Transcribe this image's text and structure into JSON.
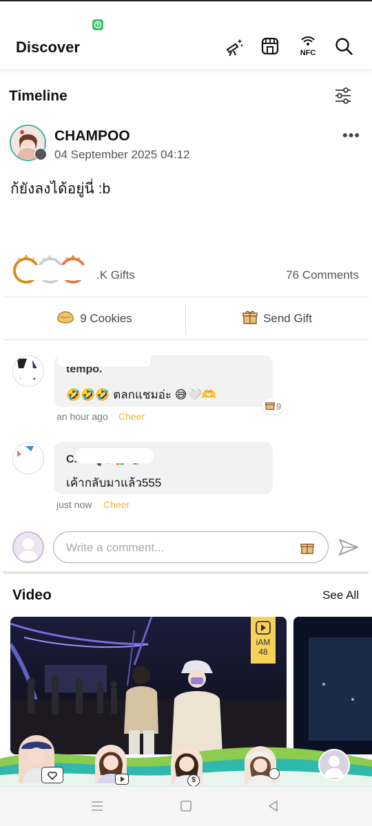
{
  "header": {
    "title": "Discover",
    "icons": [
      "telescope-icon",
      "store-icon",
      "nfc-icon",
      "search-icon"
    ],
    "nfc_label": "NFC"
  },
  "timeline": {
    "title": "Timeline",
    "post": {
      "author": "CHAMPOO",
      "date": "04 September 2025 04:12",
      "text": "ก้ยังลงได้อยู่นี่ :b",
      "gifts_label": ".K Gifts",
      "comments_label": "76 Comments"
    },
    "actions": {
      "cookies": "9 Cookies",
      "send_gift": "Send Gift"
    },
    "comments": [
      {
        "author": "tempo.",
        "text": "🤣🤣🤣 ตลกแชมอ่ะ 😅🤍🫶",
        "time": "an hour ago",
        "cheer": "Cheer",
        "gift_count": "9"
      },
      {
        "author": "C... ...ฐู💛🌈🦖",
        "text": "เค้ากลับมาแล้ว555",
        "time": "just now",
        "cheer": "Cheer"
      }
    ],
    "comment_input": {
      "placeholder": "Write a comment..."
    }
  },
  "video": {
    "title": "Video",
    "see_all": "See All",
    "badge_line1": "iAM",
    "badge_line2": "48"
  },
  "colors": {
    "accent_green": "#3cc36b",
    "cheer": "#f0b63c",
    "wave_green": "#7cc84b",
    "wave_teal": "#2bbfb0"
  }
}
